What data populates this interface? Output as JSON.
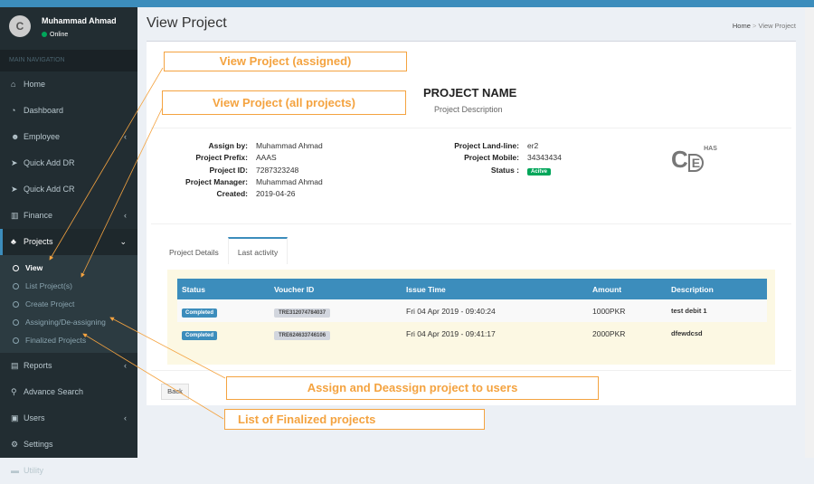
{
  "user": {
    "name": "Muhammad Ahmad",
    "status": "Online",
    "logo_text": "CoD"
  },
  "sidebar": {
    "header": "MAIN NAVIGATION",
    "items": [
      {
        "label": "Home",
        "icon": "home-icon",
        "glyph": "⌂"
      },
      {
        "label": "Dashboard",
        "icon": "dashboard-icon",
        "glyph": "◔"
      },
      {
        "label": "Employee",
        "icon": "users-icon",
        "glyph": "☻",
        "chev": "‹"
      },
      {
        "label": "Quick Add DR",
        "icon": "rocket-icon",
        "glyph": "➤"
      },
      {
        "label": "Quick Add CR",
        "icon": "rocket-icon",
        "glyph": "➤"
      },
      {
        "label": "Finance",
        "icon": "bar-chart-icon",
        "glyph": "▥",
        "chev": "‹"
      },
      {
        "label": "Projects",
        "icon": "tree-icon",
        "glyph": "♣",
        "chev": "⌄"
      },
      {
        "label": "Reports",
        "icon": "file-icon",
        "glyph": "▤",
        "chev": "‹"
      },
      {
        "label": "Advance Search",
        "icon": "search-icon",
        "glyph": "⚲"
      },
      {
        "label": "Users",
        "icon": "lock-icon",
        "glyph": "▣",
        "chev": "‹"
      },
      {
        "label": "Settings",
        "icon": "gears-icon",
        "glyph": "⚙"
      },
      {
        "label": "Utility",
        "icon": "utility-icon",
        "glyph": "▬"
      }
    ],
    "sub": [
      "View",
      "List Project(s)",
      "Create Project",
      "Assigning/De-assigning",
      "Finalized Projects"
    ]
  },
  "page": {
    "title": "View Project",
    "breadcrumb": [
      "Home",
      "View Project"
    ],
    "sep": ">"
  },
  "project": {
    "name": "PROJECT NAME",
    "description": "Project Description",
    "left": [
      {
        "k": "Assign by:",
        "v": "Muhammad Ahmad"
      },
      {
        "k": "Project Prefix:",
        "v": "AAAS"
      },
      {
        "k": "Project ID:",
        "v": "7287323248"
      },
      {
        "k": "Project Manager:",
        "v": "Muhammad Ahmad"
      },
      {
        "k": "Created:",
        "v": "2019-04-26"
      }
    ],
    "right": [
      {
        "k": "Project Land-line:",
        "v": "er2"
      },
      {
        "k": "Project Mobile:",
        "v": "34343434"
      },
      {
        "k": "Status :",
        "v": "Acitve"
      }
    ],
    "logo_text": "CoD HAS"
  },
  "tabs": [
    "Project Details",
    "Last activity"
  ],
  "table": {
    "headers": [
      "Status",
      "Voucher ID",
      "Issue Time",
      "Amount",
      "Description"
    ],
    "rows": [
      [
        "Completed",
        "TRE312074784037",
        "Fri 04 Apr 2019 - 09:40:24",
        "1000PKR",
        "test debit 1"
      ],
      [
        "Completed",
        "TRE624633746106",
        "Fri 04 Apr 2019 - 09:41:17",
        "2000PKR",
        "dfewdcsd"
      ]
    ]
  },
  "back_label": "Back",
  "annotations": [
    "View Project (assigned)",
    "View Project (all projects)",
    "Assign and Deassign project to users",
    "List of Finalized projects"
  ],
  "colors": {
    "accent": "#3c8dbc",
    "sidebar": "#222d32",
    "annotation": "#f4a340",
    "success": "#00a65a"
  }
}
